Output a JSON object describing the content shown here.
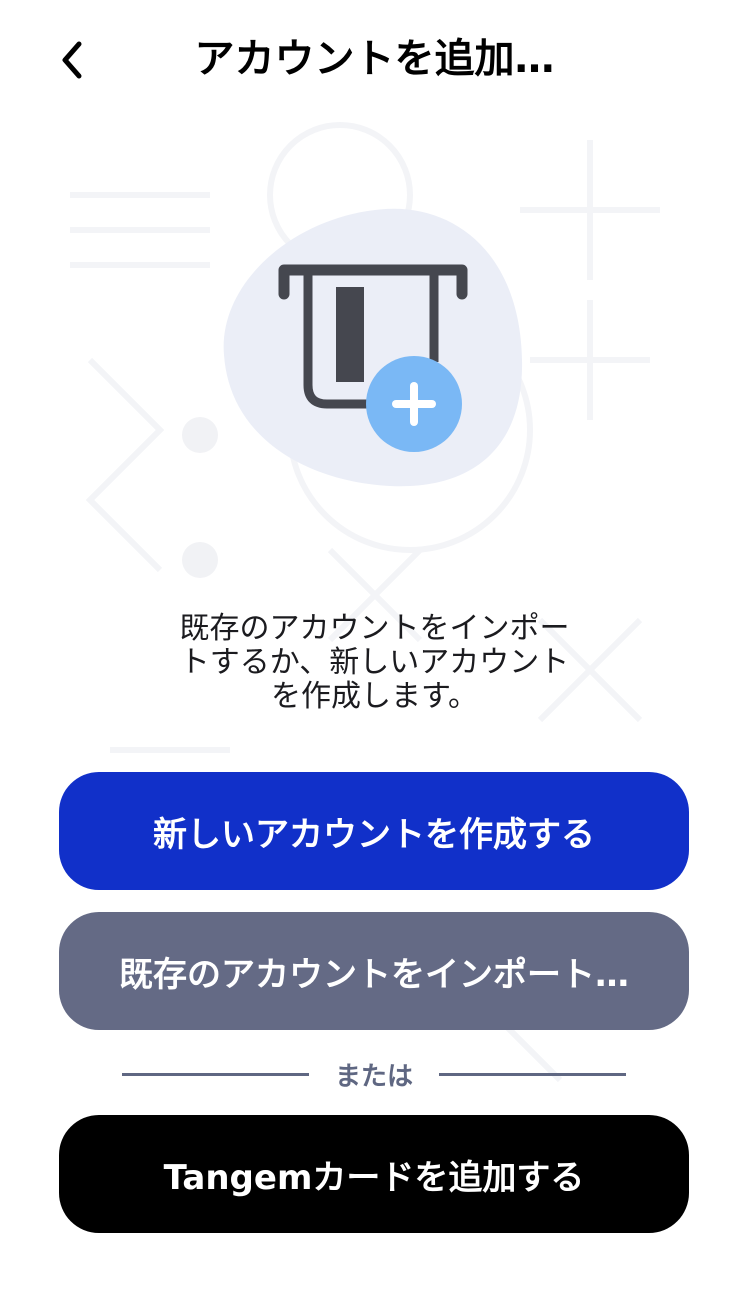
{
  "header": {
    "back_icon": "chevron-left-icon",
    "title": "アカウントを追加…"
  },
  "illustration": {
    "icon": "card-add-icon",
    "plus_icon": "plus-icon",
    "accent": "#7ab8f5",
    "blob": "#e9ecf6"
  },
  "description": {
    "lines": [
      "既存のアカウントをインポー",
      "トするか、新しいアカウント",
      "を作成します。"
    ]
  },
  "buttons": {
    "create_label": "新しいアカウントを作成する",
    "import_label": "既存のアカウントをインポート…",
    "tangem_label": "Tangemカードを追加する"
  },
  "divider": {
    "label": "または"
  },
  "colors": {
    "primary": "#1130c9",
    "secondary": "#646a85",
    "dark": "#000000",
    "divider": "#5f6782"
  }
}
